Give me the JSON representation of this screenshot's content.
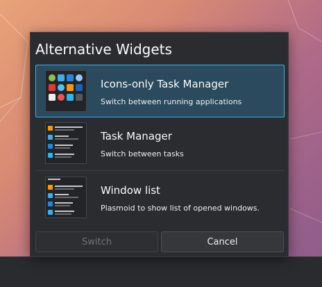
{
  "dialog": {
    "title": "Alternative Widgets",
    "items": [
      {
        "title": "Icons-only Task Manager",
        "description": "Switch between running applications",
        "selected": true,
        "preview_icon": "icons-only-task-manager-preview"
      },
      {
        "title": "Task Manager",
        "description": "Switch between tasks",
        "selected": false,
        "preview_icon": "task-manager-preview"
      },
      {
        "title": "Window list",
        "description": "Plasmoid to show list of opened windows.",
        "selected": false,
        "preview_icon": "window-list-preview"
      }
    ],
    "buttons": {
      "switch_label": "Switch",
      "cancel_label": "Cancel",
      "switch_enabled": false
    }
  },
  "colors": {
    "accent": "#3daee9",
    "selected_bg": "#2b4a5e",
    "dialog_bg": "#2b2c30",
    "text": "#fcfcfc"
  }
}
